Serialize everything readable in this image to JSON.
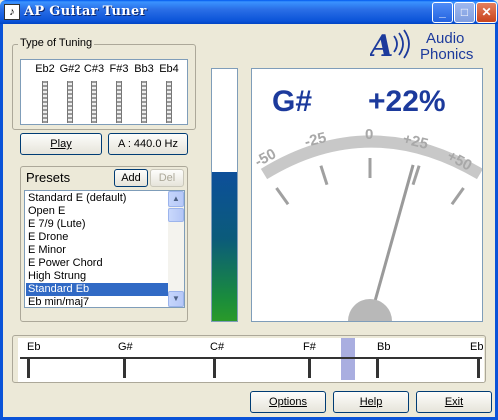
{
  "window": {
    "title": "AP Guitar Tuner"
  },
  "tuning_group": {
    "label": "Type of Tuning",
    "strings": [
      "Eb2",
      "G#2",
      "C#3",
      "F#3",
      "Bb3",
      "Eb4"
    ]
  },
  "controls": {
    "play_label": "Play",
    "a_label": "A : 440.0 Hz"
  },
  "presets": {
    "label": "Presets",
    "add_label": "Add",
    "del_label": "Del",
    "items": [
      "Standard E (default)",
      "Open E",
      "E 7/9 (Lute)",
      "E Drone",
      "E Minor",
      "E Power Chord",
      "High Strung",
      "Standard Eb",
      "Eb min/maj7"
    ],
    "selected_index": 7
  },
  "level": {
    "fraction": 0.59
  },
  "meter": {
    "note": "G#",
    "cents": "+22%",
    "cents_value": 22,
    "scale_labels": [
      "-50",
      "-25",
      "0",
      "+25",
      "+50"
    ]
  },
  "strobe": {
    "notes": [
      "Eb",
      "G#",
      "C#",
      "F#",
      "Bb",
      "Eb"
    ]
  },
  "logo": {
    "line1": "Audio",
    "line2": "Phonics"
  },
  "footer": {
    "options_label": "Options",
    "help_label": "Help",
    "exit_label": "Exit"
  },
  "colors": {
    "title_bar": "#0a53d8",
    "note_text": "#1c3a9c",
    "selection": "#316ac5",
    "strobe_marker": "#a9aee0"
  }
}
